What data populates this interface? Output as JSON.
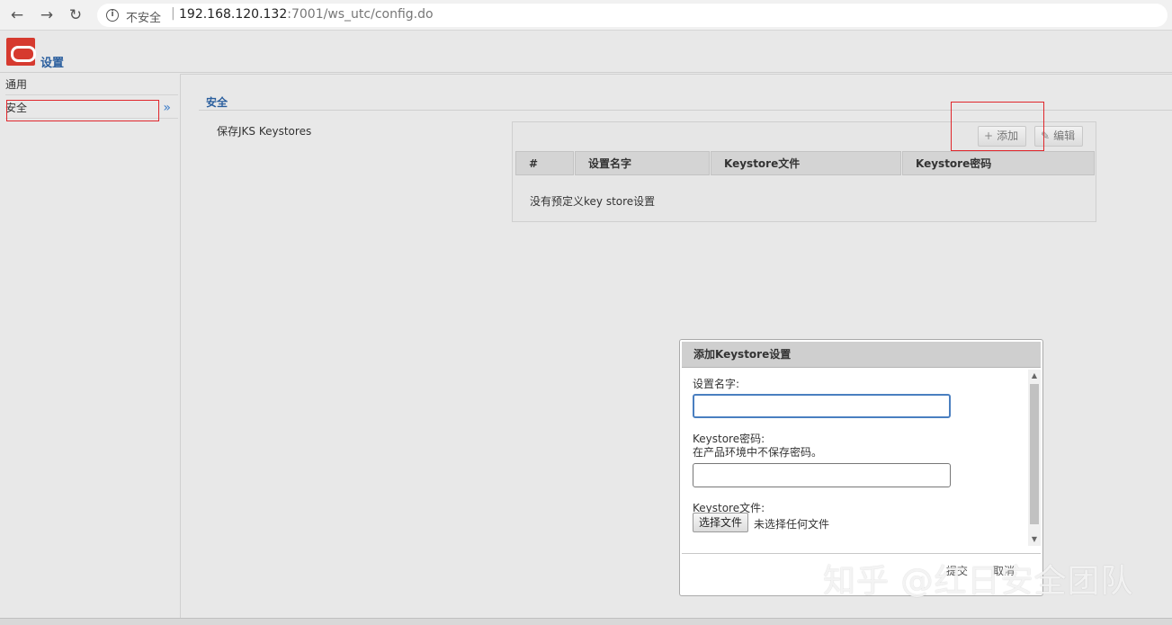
{
  "browser": {
    "insecure_label": "不安全",
    "url_host": "192.168.120.132",
    "url_path": ":7001/ws_utc/config.do"
  },
  "header": {
    "title": "设置"
  },
  "sidebar": {
    "items": [
      {
        "label": "通用"
      },
      {
        "label": "安全",
        "chevron": "»"
      }
    ]
  },
  "main": {
    "section_title": "安全",
    "form_label": "保存JKS Keystores",
    "toolbar": {
      "add_label": "添加",
      "edit_label": "编辑"
    },
    "table": {
      "columns": [
        "#",
        "设置名字",
        "Keystore文件",
        "Keystore密码"
      ],
      "empty_message": "没有预定义key store设置"
    }
  },
  "dialog": {
    "title": "添加Keystore设置",
    "name_label": "设置名字:",
    "name_value": "",
    "password_label": "Keystore密码:",
    "password_hint": "在产品环境中不保存密码。",
    "password_value": "",
    "file_label": "Keystore文件:",
    "file_button": "选择文件",
    "file_status": "未选择任何文件",
    "submit_label": "提交",
    "cancel_label": "取消"
  },
  "watermark": "知乎 @红日安全团队",
  "colors": {
    "accent": "#2b5f9e",
    "highlight_box": "#e0262b",
    "logo": "#d63a2f"
  }
}
